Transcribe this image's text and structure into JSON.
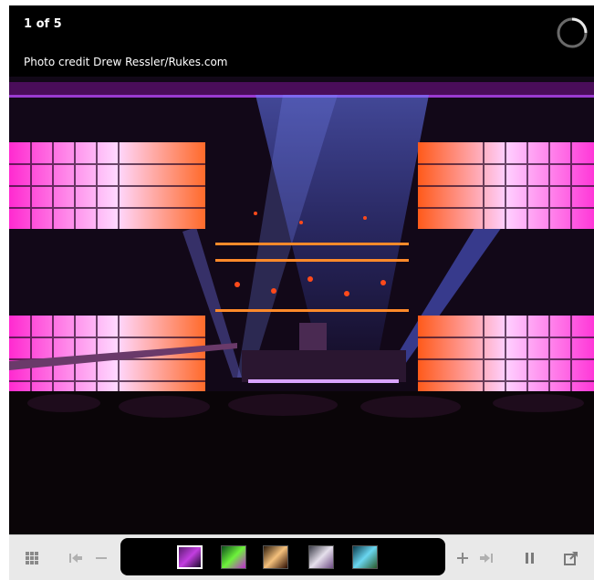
{
  "viewer": {
    "counter": "1 of 5",
    "credit": "Photo credit Drew Ressler/Rukes.com"
  },
  "toolbar": {
    "grid_icon": "grid-icon",
    "first_icon": "first-icon",
    "zoom_out_icon": "minus-icon",
    "zoom_in_icon": "plus-icon",
    "last_icon": "last-icon",
    "pause_icon": "pause-icon",
    "popout_icon": "external-window-icon"
  },
  "thumbnails": [
    {
      "colors": [
        "#5a1d6f",
        "#c23ee0",
        "#1a0a2a"
      ],
      "active": true
    },
    {
      "colors": [
        "#0d4d1c",
        "#6df23b",
        "#c22ad2"
      ],
      "active": false
    },
    {
      "colors": [
        "#2c1a0a",
        "#f4c07c",
        "#2a0b00"
      ],
      "active": false
    },
    {
      "colors": [
        "#3b3c48",
        "#e6e0ec",
        "#6e4c84"
      ],
      "active": false
    },
    {
      "colors": [
        "#0a3a4a",
        "#6ad6f0",
        "#2b5a2b"
      ],
      "active": false
    }
  ]
}
